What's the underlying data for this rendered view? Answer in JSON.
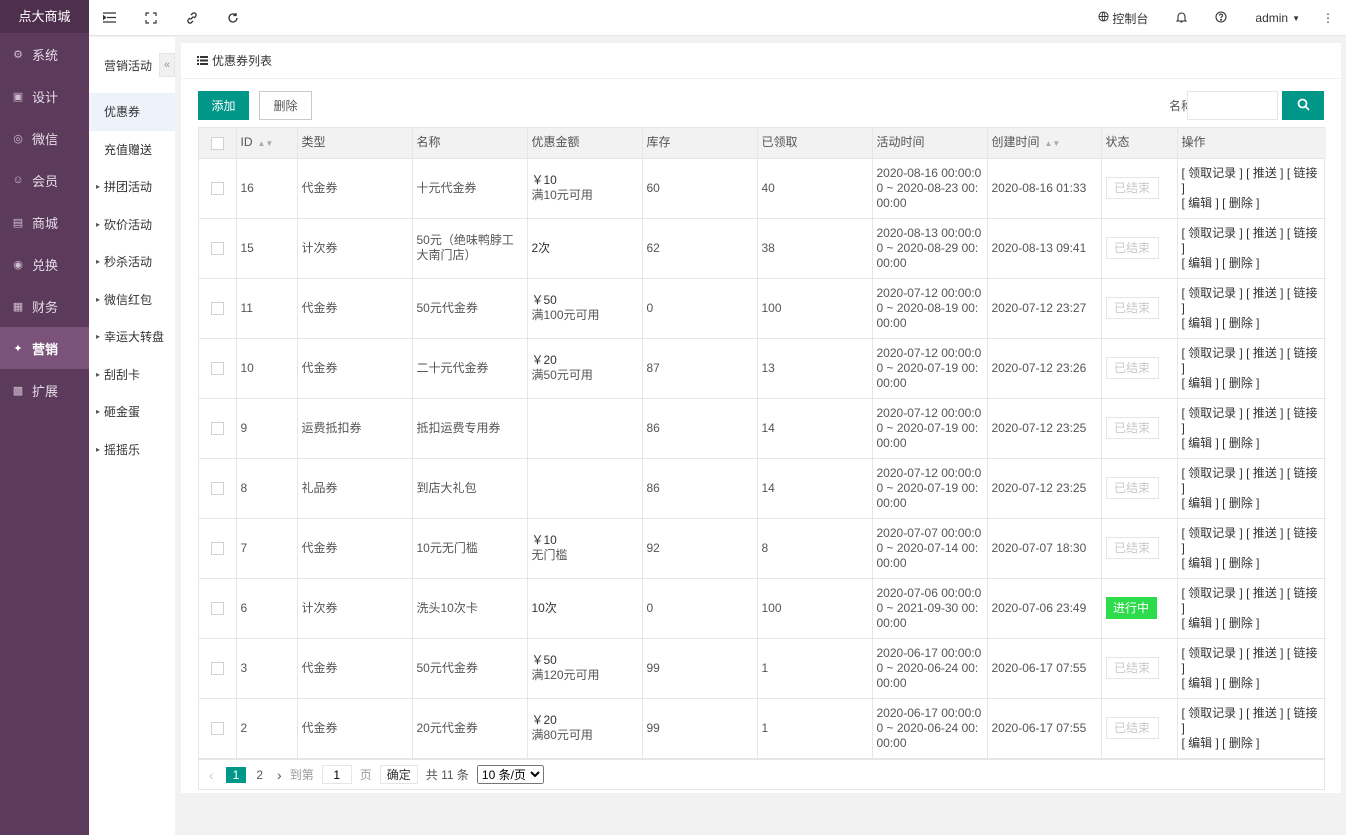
{
  "brand": "点大商城",
  "nav": [
    {
      "icon": "gear-icon",
      "glyph": "⚙",
      "label": "系统"
    },
    {
      "icon": "design-icon",
      "glyph": "▣",
      "label": "设计"
    },
    {
      "icon": "wechat-icon",
      "glyph": "◎",
      "label": "微信"
    },
    {
      "icon": "user-icon",
      "glyph": "☺",
      "label": "会员"
    },
    {
      "icon": "shop-icon",
      "glyph": "▤",
      "label": "商城"
    },
    {
      "icon": "exchange-icon",
      "glyph": "◉",
      "label": "兑换"
    },
    {
      "icon": "finance-icon",
      "glyph": "▦",
      "label": "财务"
    },
    {
      "icon": "gift-icon",
      "glyph": "✦",
      "label": "营销",
      "active": true
    },
    {
      "icon": "grid-icon",
      "glyph": "▩",
      "label": "扩展"
    }
  ],
  "submenu": {
    "title": "营销活动",
    "collapse": "«",
    "items": [
      {
        "label": "优惠券",
        "arrow": "",
        "active": true
      },
      {
        "label": "充值赠送",
        "arrow": ""
      },
      {
        "label": "拼团活动",
        "arrow": "▸"
      },
      {
        "label": "砍价活动",
        "arrow": "▸"
      },
      {
        "label": "秒杀活动",
        "arrow": "▸"
      },
      {
        "label": "微信红包",
        "arrow": "▸"
      },
      {
        "label": "幸运大转盘",
        "arrow": "▸"
      },
      {
        "label": "刮刮卡",
        "arrow": "▸"
      },
      {
        "label": "砸金蛋",
        "arrow": "▸"
      },
      {
        "label": "摇摇乐",
        "arrow": "▸"
      }
    ]
  },
  "topbar": {
    "console": "控制台",
    "user": "admin"
  },
  "card": {
    "title": "优惠券列表",
    "add_label": "添加",
    "delete_label": "删除",
    "search_label": "名称",
    "search_value": "",
    "search_placeholder": ""
  },
  "table": {
    "headers": [
      "ID",
      "类型",
      "名称",
      "优惠金额",
      "库存",
      "已领取",
      "活动时间",
      "创建时间",
      "状态",
      "操作"
    ],
    "ops_line1": "[ 领取记录 ] [ 推送 ] [ 链接 ]",
    "ops_line2": "[ 编辑 ] [ 删除 ]",
    "rows": [
      {
        "id": "16",
        "type": "代金券",
        "name": "十元代金券",
        "amount": "￥10",
        "cond": "满10元可用",
        "stock": "60",
        "received": "40",
        "time": "2020-08-16 00:00:00 ~ 2020-08-23 00:00:00",
        "created": "2020-08-16 01:33",
        "status": "已结束",
        "status_on": false
      },
      {
        "id": "15",
        "type": "计次券",
        "name": "50元（绝味鸭脖工大南门店）",
        "amount": "2次",
        "cond": "",
        "stock": "62",
        "received": "38",
        "time": "2020-08-13 00:00:00 ~ 2020-08-29 00:00:00",
        "created": "2020-08-13 09:41",
        "status": "已结束",
        "status_on": false
      },
      {
        "id": "11",
        "type": "代金券",
        "name": "50元代金券",
        "amount": "￥50",
        "cond": "满100元可用",
        "stock": "0",
        "received": "100",
        "time": "2020-07-12 00:00:00 ~ 2020-08-19 00:00:00",
        "created": "2020-07-12 23:27",
        "status": "已结束",
        "status_on": false
      },
      {
        "id": "10",
        "type": "代金券",
        "name": "二十元代金券",
        "amount": "￥20",
        "cond": "满50元可用",
        "stock": "87",
        "received": "13",
        "time": "2020-07-12 00:00:00 ~ 2020-07-19 00:00:00",
        "created": "2020-07-12 23:26",
        "status": "已结束",
        "status_on": false
      },
      {
        "id": "9",
        "type": "运费抵扣券",
        "name": "抵扣运费专用券",
        "amount": "",
        "cond": "",
        "stock": "86",
        "received": "14",
        "time": "2020-07-12 00:00:00 ~ 2020-07-19 00:00:00",
        "created": "2020-07-12 23:25",
        "status": "已结束",
        "status_on": false
      },
      {
        "id": "8",
        "type": "礼品券",
        "name": "到店大礼包",
        "amount": "",
        "cond": "",
        "stock": "86",
        "received": "14",
        "time": "2020-07-12 00:00:00 ~ 2020-07-19 00:00:00",
        "created": "2020-07-12 23:25",
        "status": "已结束",
        "status_on": false
      },
      {
        "id": "7",
        "type": "代金券",
        "name": "10元无门槛",
        "amount": "￥10",
        "cond": "无门槛",
        "stock": "92",
        "received": "8",
        "time": "2020-07-07 00:00:00 ~ 2020-07-14 00:00:00",
        "created": "2020-07-07 18:30",
        "status": "已结束",
        "status_on": false
      },
      {
        "id": "6",
        "type": "计次券",
        "name": "洗头10次卡",
        "amount": "10次",
        "cond": "",
        "stock": "0",
        "received": "100",
        "time": "2020-07-06 00:00:00 ~ 2021-09-30 00:00:00",
        "created": "2020-07-06 23:49",
        "status": "进行中",
        "status_on": true
      },
      {
        "id": "3",
        "type": "代金券",
        "name": "50元代金券",
        "amount": "￥50",
        "cond": "满120元可用",
        "stock": "99",
        "received": "1",
        "time": "2020-06-17 00:00:00 ~ 2020-06-24 00:00:00",
        "created": "2020-06-17 07:55",
        "status": "已结束",
        "status_on": false
      },
      {
        "id": "2",
        "type": "代金券",
        "name": "20元代金券",
        "amount": "￥20",
        "cond": "满80元可用",
        "stock": "99",
        "received": "1",
        "time": "2020-06-17 00:00:00 ~ 2020-06-24 00:00:00",
        "created": "2020-06-17 07:55",
        "status": "已结束",
        "status_on": false
      }
    ]
  },
  "pager": {
    "prev": "‹",
    "current": "1",
    "page2": "2",
    "next": "›",
    "goto_label": "到第",
    "goto_value": "1",
    "page_unit": "页",
    "confirm": "确定",
    "total": "共 11 条",
    "page_size": "10 条/页"
  }
}
